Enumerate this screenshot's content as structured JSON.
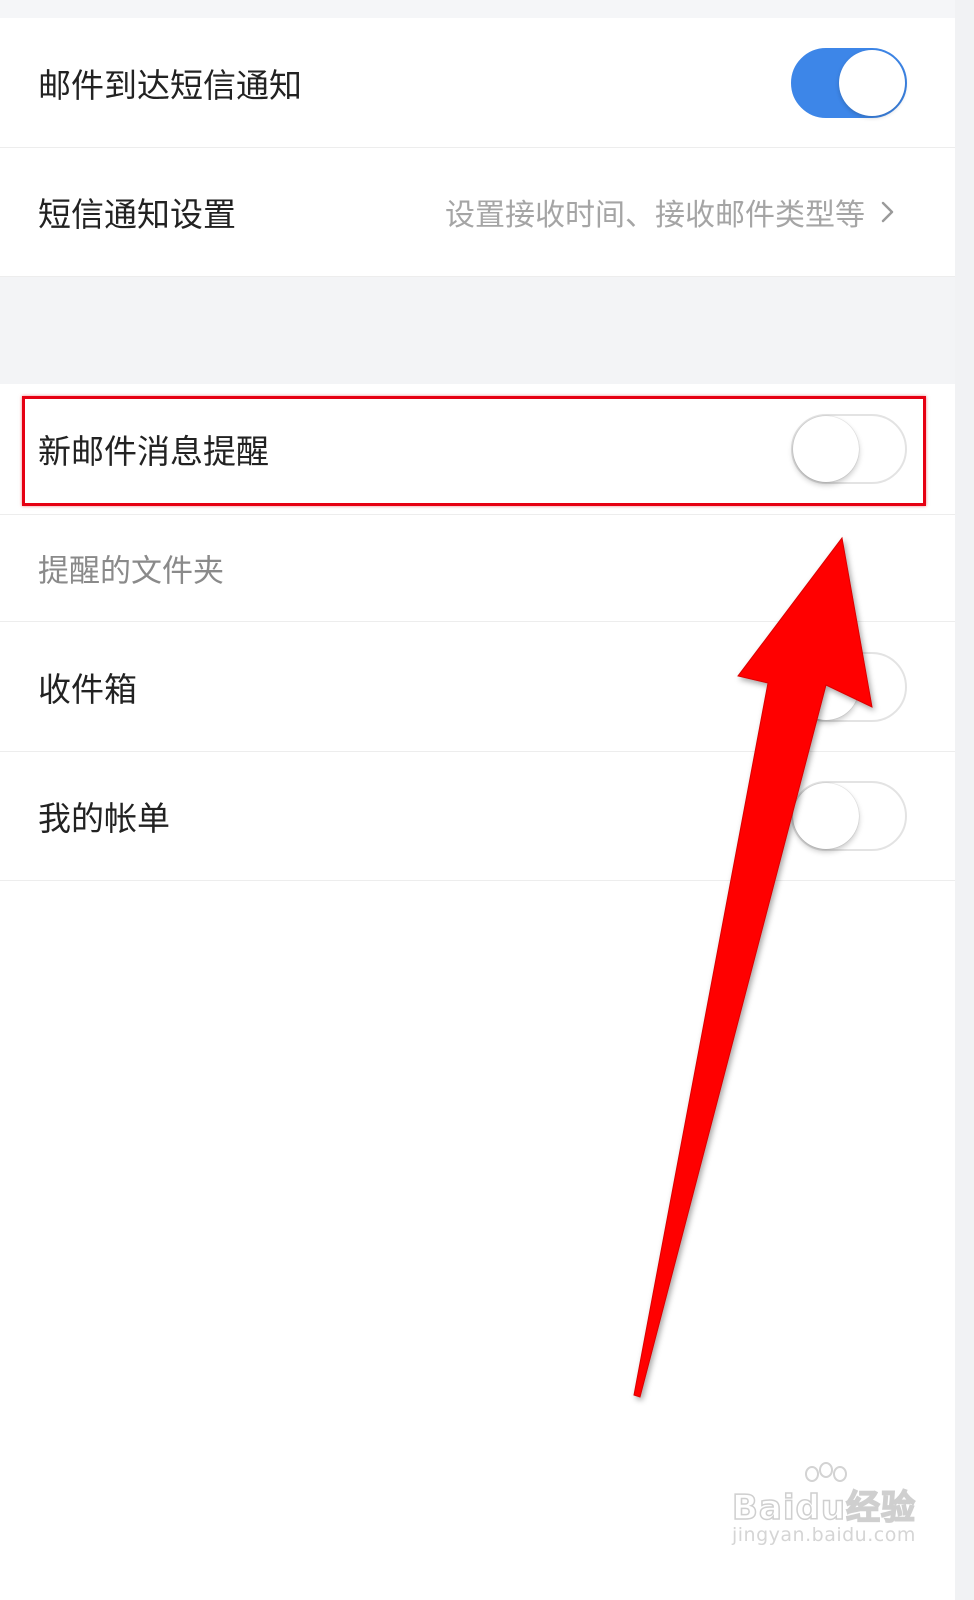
{
  "sms_arrival": {
    "label": "邮件到达短信通知",
    "enabled": true
  },
  "sms_settings": {
    "label": "短信通知设置",
    "description": "设置接收时间、接收邮件类型等"
  },
  "new_mail_reminder": {
    "label": "新邮件消息提醒",
    "enabled": false
  },
  "reminder_folders": {
    "header": "提醒的文件夹",
    "items": [
      {
        "label": "收件箱",
        "enabled": false
      },
      {
        "label": "我的帐单",
        "enabled": false
      }
    ]
  },
  "annotation": {
    "highlight_color": "#e60012",
    "arrow_color": "#ff0000"
  },
  "watermark": {
    "logo": "Baidu经验",
    "url": "jingyan.baidu.com"
  },
  "colors": {
    "toggle_on": "#3d86e8",
    "section_bg": "#f3f4f6"
  }
}
